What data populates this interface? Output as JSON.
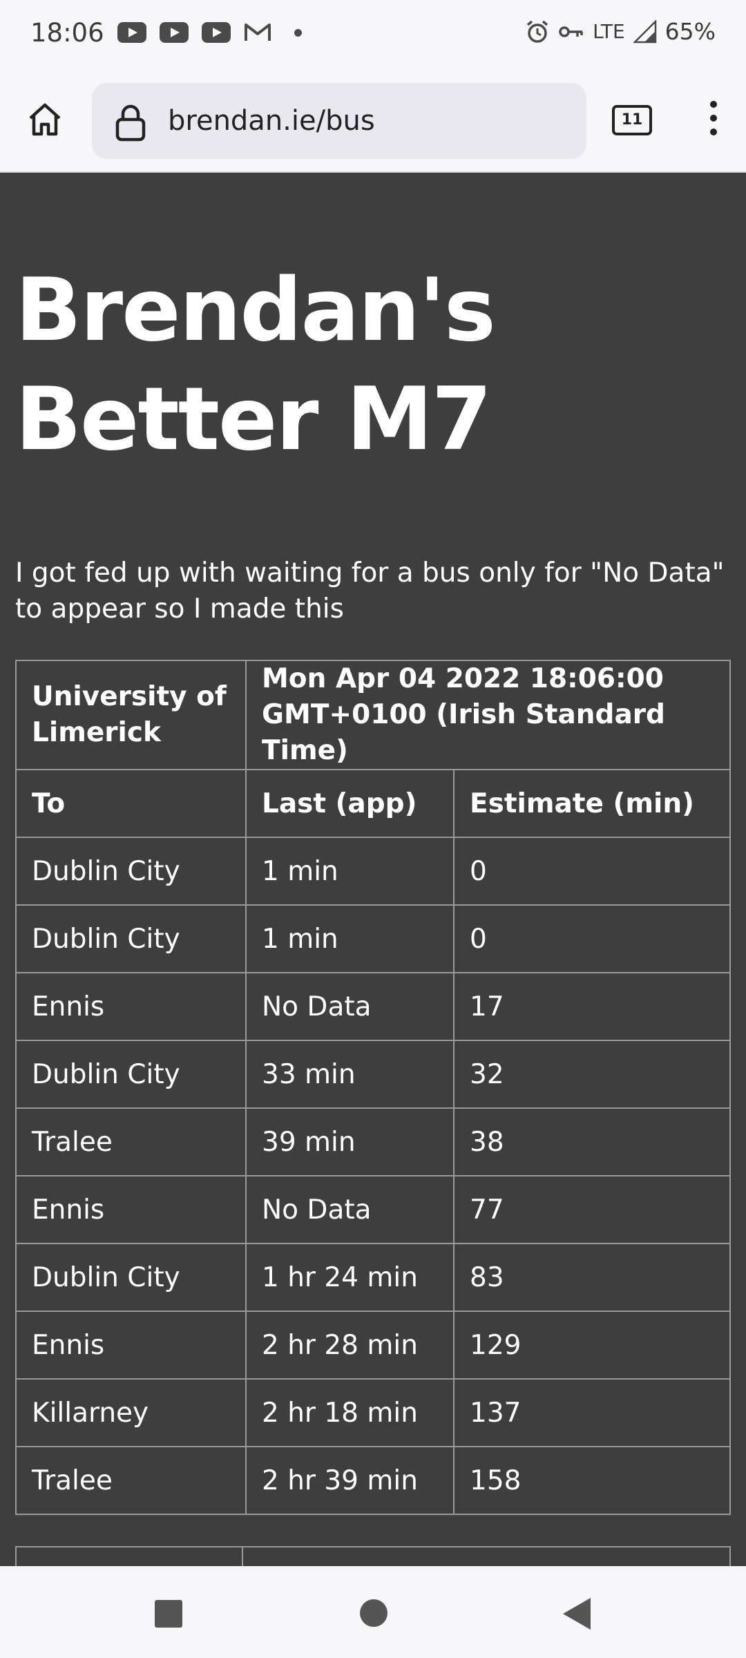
{
  "status_bar": {
    "time": "18:06",
    "network": "LTE",
    "battery": "65%",
    "notification_icons": [
      "youtube-icon",
      "youtube-icon",
      "youtube-icon",
      "gmail-icon",
      "dot-icon"
    ],
    "system_icons": [
      "alarm-icon",
      "vpn-key-icon",
      "lte-label",
      "signal-icon",
      "battery-text"
    ]
  },
  "browser": {
    "url": "brendan.ie/bus",
    "tab_count": "11"
  },
  "page": {
    "title": "Brendan's Better M7",
    "intro": "I got fed up with waiting for a bus only for \"No Data\" to appear so I made this",
    "table": {
      "stop_name": "University of Limerick",
      "timestamp": "Mon Apr 04 2022 18:06:00 GMT+0100 (Irish Standard Time)",
      "headers": [
        "To",
        "Last (app)",
        "Estimate (min)"
      ],
      "rows": [
        [
          "Dublin City",
          "1 min",
          "0"
        ],
        [
          "Dublin City",
          "1 min",
          "0"
        ],
        [
          "Ennis",
          "No Data",
          "17"
        ],
        [
          "Dublin City",
          "33 min",
          "32"
        ],
        [
          "Tralee",
          "39 min",
          "38"
        ],
        [
          "Ennis",
          "No Data",
          "77"
        ],
        [
          "Dublin City",
          "1 hr 24 min",
          "83"
        ],
        [
          "Ennis",
          "2 hr 28 min",
          "129"
        ],
        [
          "Killarney",
          "2 hr 18 min",
          "137"
        ],
        [
          "Tralee",
          "2 hr 39 min",
          "158"
        ]
      ]
    }
  },
  "nav_bar": {
    "buttons": [
      "recents-button",
      "home-button",
      "back-button"
    ]
  },
  "colors": {
    "page_background": "#3e3e3e",
    "text": "#ffffff",
    "table_border": "#9a9a9a",
    "chrome_background": "#f7f7fa"
  }
}
